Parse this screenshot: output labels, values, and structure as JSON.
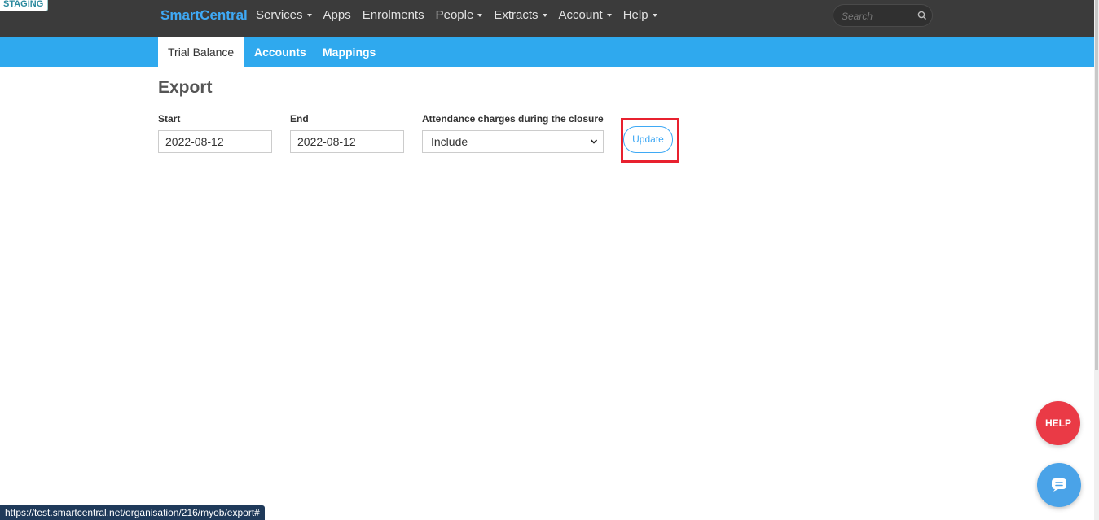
{
  "env_badge": "STAGING",
  "brand": "SmartCentral",
  "nav": [
    {
      "label": "Services",
      "dropdown": true
    },
    {
      "label": "Apps",
      "dropdown": false
    },
    {
      "label": "Enrolments",
      "dropdown": false
    },
    {
      "label": "People",
      "dropdown": true
    },
    {
      "label": "Extracts",
      "dropdown": true
    },
    {
      "label": "Account",
      "dropdown": true
    },
    {
      "label": "Help",
      "dropdown": true
    }
  ],
  "search": {
    "placeholder": "Search",
    "icon": "search-icon"
  },
  "subnav": {
    "trial_balance": "Trial Balance",
    "accounts": "Accounts",
    "mappings": "Mappings"
  },
  "page": {
    "title": "Export"
  },
  "form": {
    "start_label": "Start",
    "start_value": "2022-08-12",
    "end_label": "End",
    "end_value": "2022-08-12",
    "attendance_label": "Attendance charges during the closure",
    "attendance_value": "Include",
    "update_label": "Update"
  },
  "help_label": "HELP",
  "status_url": "https://test.smartcentral.net/organisation/216/myob/export#",
  "colors": {
    "brand": "#3fa9f5",
    "navbar": "#3b3b3b",
    "subbar": "#2fa9ee",
    "help": "#ea3a46",
    "highlight": "#e8212f"
  }
}
